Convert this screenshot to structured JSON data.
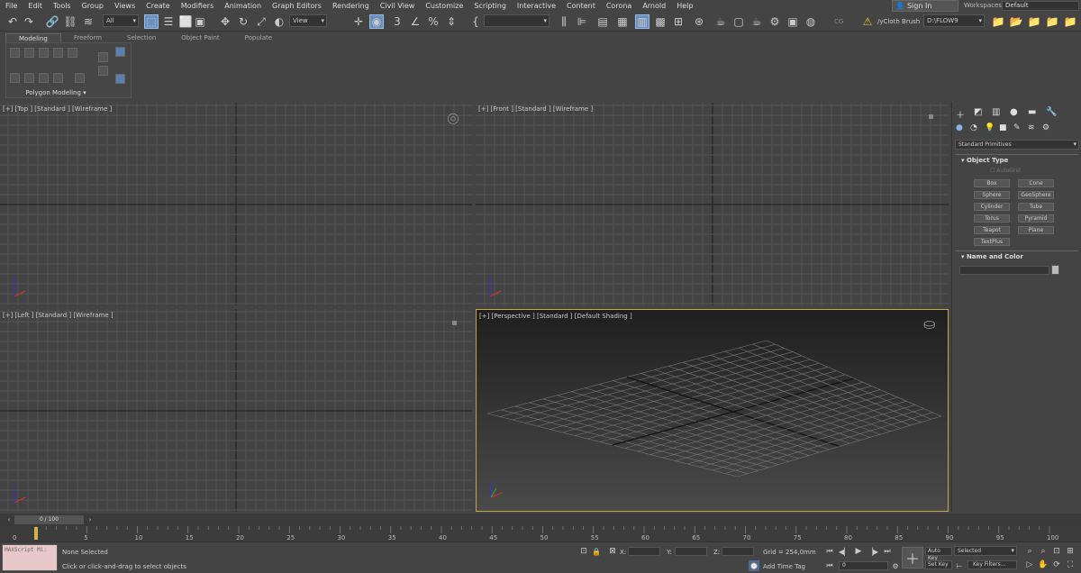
{
  "menu": [
    "File",
    "Edit",
    "Tools",
    "Group",
    "Views",
    "Create",
    "Modifiers",
    "Animation",
    "Graph Editors",
    "Rendering",
    "Civil View",
    "Customize",
    "Scripting",
    "Interactive",
    "Content",
    "Corona",
    "Arnold",
    "Help"
  ],
  "signin_label": "Sign In",
  "workspace": {
    "label": "Workspaces:",
    "value": "Default"
  },
  "toolbar": {
    "selection_filter": "All",
    "ref_coord": "View",
    "scene_brush": "/yCloth Brush",
    "project_path": "D:\\FLOW9",
    "cg_label": "CG"
  },
  "ribbon": {
    "tabs": [
      "Modeling",
      "Freeform",
      "Selection",
      "Object Paint",
      "Populate"
    ],
    "selected_tab": "Modeling",
    "panel_label": "Polygon Modeling"
  },
  "viewports": {
    "top": "[+] [Top ] [Standard ] [Wireframe ]",
    "front": "[+] [Front ] [Standard ] [Wireframe ]",
    "left": "[+] [Left ] [Standard ] [Wireframe ]",
    "perspective": "[+] [Perspective ] [Standard ] [Default Shading ]"
  },
  "command_panel": {
    "category": "Standard Primitives",
    "object_type_title": "Object Type",
    "autogrid": "AutoGrid",
    "object_buttons": [
      "Box",
      "Cone",
      "Sphere",
      "GeoSphere",
      "Cylinder",
      "Tube",
      "Torus",
      "Pyramid",
      "Teapot",
      "Plane",
      "TextPlus"
    ],
    "name_color_title": "Name and Color"
  },
  "timeline": {
    "frame_display": "0 / 100",
    "ticks": [
      "0",
      "5",
      "10",
      "15",
      "20",
      "25",
      "30",
      "35",
      "40",
      "45",
      "50",
      "55",
      "60",
      "65",
      "70",
      "75",
      "80",
      "85",
      "90",
      "95",
      "100"
    ]
  },
  "status": {
    "maxscript": "MAXScript Mi:",
    "selection": "None Selected",
    "prompt": "Click or click-and-drag to select objects",
    "x_label": "X:",
    "y_label": "Y:",
    "z_label": "Z:",
    "grid": "Grid = 254,0mm",
    "add_time_tag": "Add Time Tag",
    "auto_key": "Auto Key",
    "set_key": "Set Key",
    "key_mode": "Selected",
    "key_filters": "Key Filters...",
    "current_frame": "0"
  },
  "colors": {
    "accent": "#6a8fbf",
    "persp_border": "#c8a24a",
    "bg": "#444444"
  }
}
